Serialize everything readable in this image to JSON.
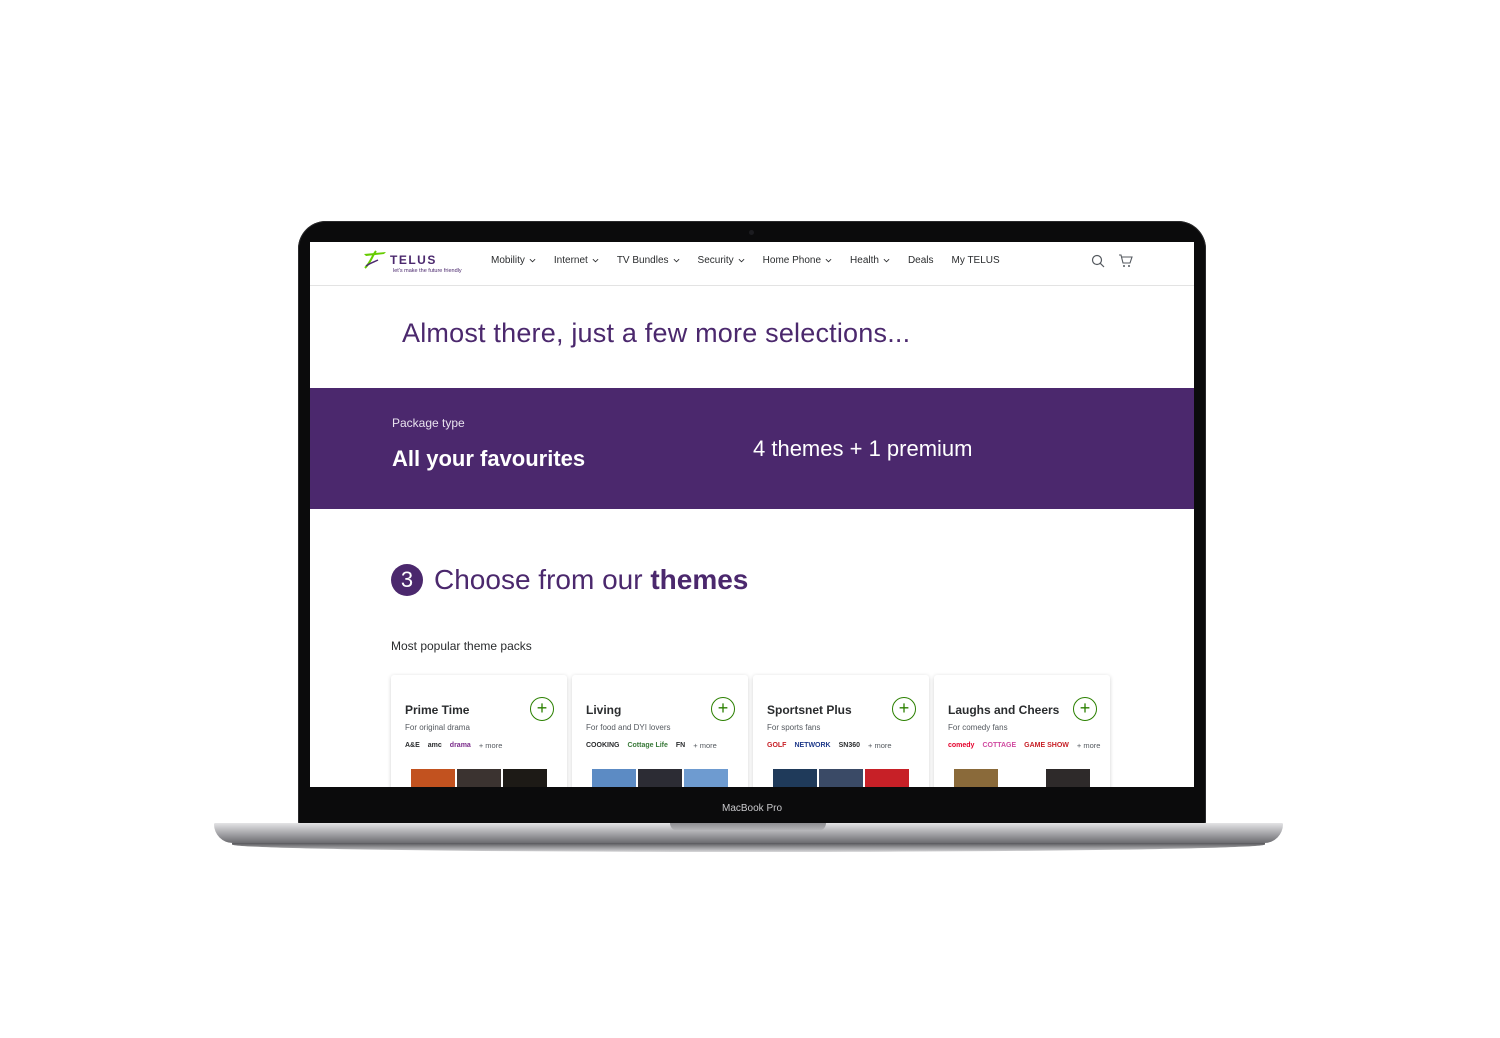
{
  "device": {
    "label": "MacBook Pro"
  },
  "nav": {
    "logo_text": "TELUS",
    "logo_tagline": "let's make the future friendly",
    "items": [
      {
        "label": "Mobility",
        "dropdown": true
      },
      {
        "label": "Internet",
        "dropdown": true
      },
      {
        "label": "TV Bundles",
        "dropdown": true
      },
      {
        "label": "Security",
        "dropdown": true
      },
      {
        "label": "Home Phone",
        "dropdown": true
      },
      {
        "label": "Health",
        "dropdown": true
      },
      {
        "label": "Deals",
        "dropdown": false
      },
      {
        "label": "My TELUS",
        "dropdown": false
      }
    ],
    "icons": [
      "search-icon",
      "cart-icon"
    ]
  },
  "headline": "Almost there, just a few more selections...",
  "package": {
    "label": "Package type",
    "name": "All your favourites",
    "detail": "4 themes + 1 premium"
  },
  "step": {
    "number": "3",
    "title_prefix": "Choose from our",
    "title_emphasis": "themes"
  },
  "popular_label": "Most popular theme packs",
  "theme_cards": [
    {
      "title": "Prime Time",
      "subtitle": "For original drama",
      "channels": [
        "A&E",
        "amc",
        "drama"
      ],
      "more": "+ more"
    },
    {
      "title": "Living",
      "subtitle": "For food and DYI lovers",
      "channels": [
        "COOKING",
        "Cottage Life",
        "FN"
      ],
      "more": "+ more"
    },
    {
      "title": "Sportsnet Plus",
      "subtitle": "For sports fans",
      "channels": [
        "GOLF",
        "NETWORK",
        "SN360"
      ],
      "more": "+ more"
    },
    {
      "title": "Laughs and Cheers",
      "subtitle": "For comedy fans",
      "channels": [
        "comedy",
        "COTTAGE",
        "GAME SHOW"
      ],
      "more": "+ more"
    }
  ],
  "colors": {
    "brand_purple": "#4b286d",
    "brand_green": "#2b8000",
    "text": "#2a2c2e"
  }
}
